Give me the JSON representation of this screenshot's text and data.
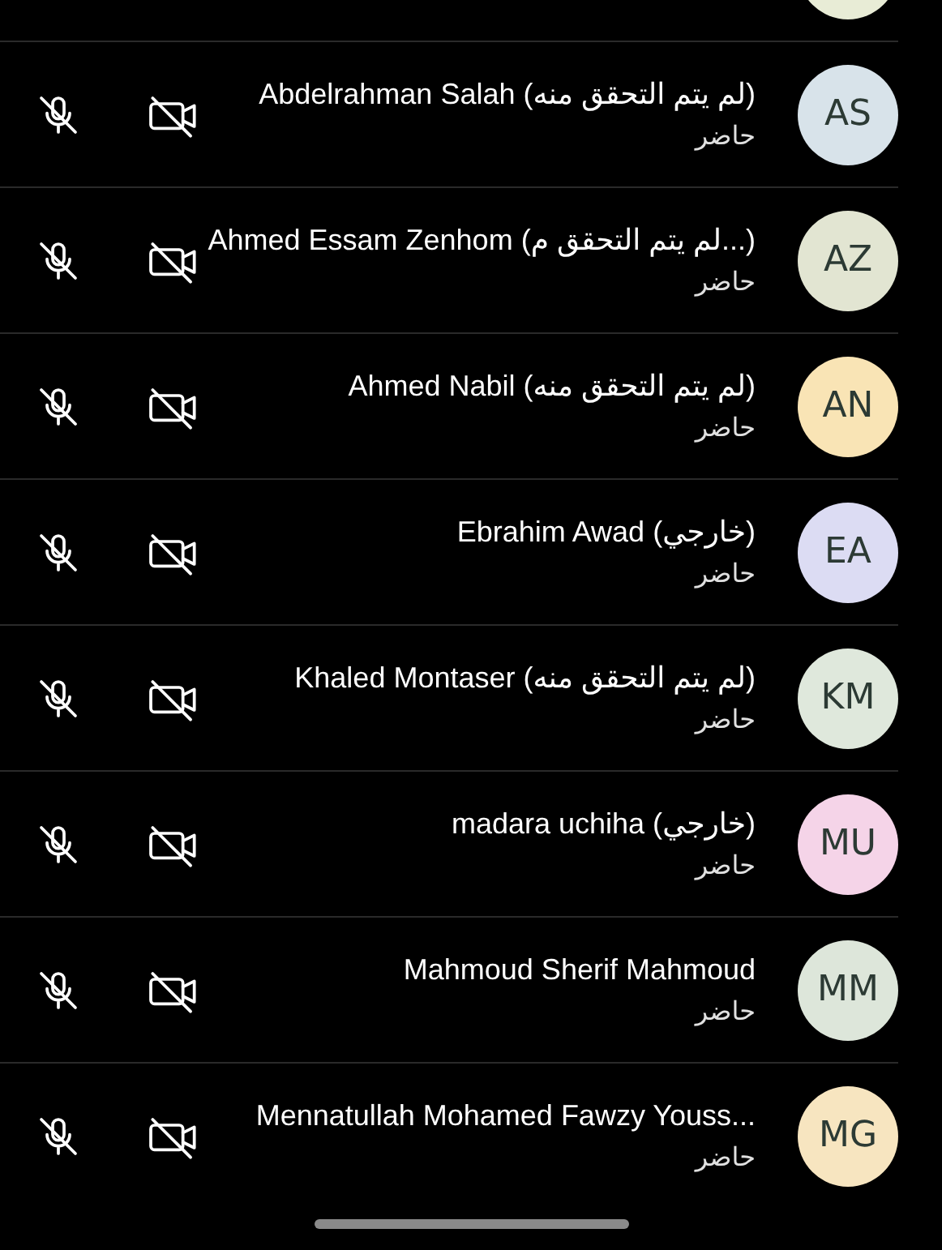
{
  "top_partial_row": {
    "color": "#e8ecd6"
  },
  "participants": [
    {
      "name": "Abdelrahman Salah (لم يتم التحقق منه)",
      "status": "حاضر",
      "initials": "AS",
      "color": "#d8e3ea",
      "mic_muted": true,
      "camera_off": true
    },
    {
      "name": "Ahmed Essam Zenhom (لم يتم التحقق م...)",
      "status": "حاضر",
      "initials": "AZ",
      "color": "#e2e5d2",
      "mic_muted": true,
      "camera_off": true
    },
    {
      "name": "Ahmed Nabil (لم يتم التحقق منه)",
      "status": "حاضر",
      "initials": "AN",
      "color": "#f9e4b5",
      "mic_muted": true,
      "camera_off": true
    },
    {
      "name": "Ebrahim Awad (خارجي)",
      "status": "حاضر",
      "initials": "EA",
      "color": "#dcdcf3",
      "mic_muted": true,
      "camera_off": true
    },
    {
      "name": "Khaled Montaser  (لم يتم التحقق منه)",
      "status": "حاضر",
      "initials": "KM",
      "color": "#dfe8dc",
      "mic_muted": true,
      "camera_off": true
    },
    {
      "name": "madara uchiha (خارجي)",
      "status": "حاضر",
      "initials": "MU",
      "color": "#f5d4e8",
      "mic_muted": true,
      "camera_off": true
    },
    {
      "name": "Mahmoud Sherif Mahmoud",
      "status": "حاضر",
      "initials": "MM",
      "color": "#dde6da",
      "mic_muted": true,
      "camera_off": true
    },
    {
      "name": "Mennatullah Mohamed Fawzy Youss...",
      "status": "حاضر",
      "initials": "MG",
      "color": "#f7e5c0",
      "mic_muted": true,
      "camera_off": true
    }
  ]
}
